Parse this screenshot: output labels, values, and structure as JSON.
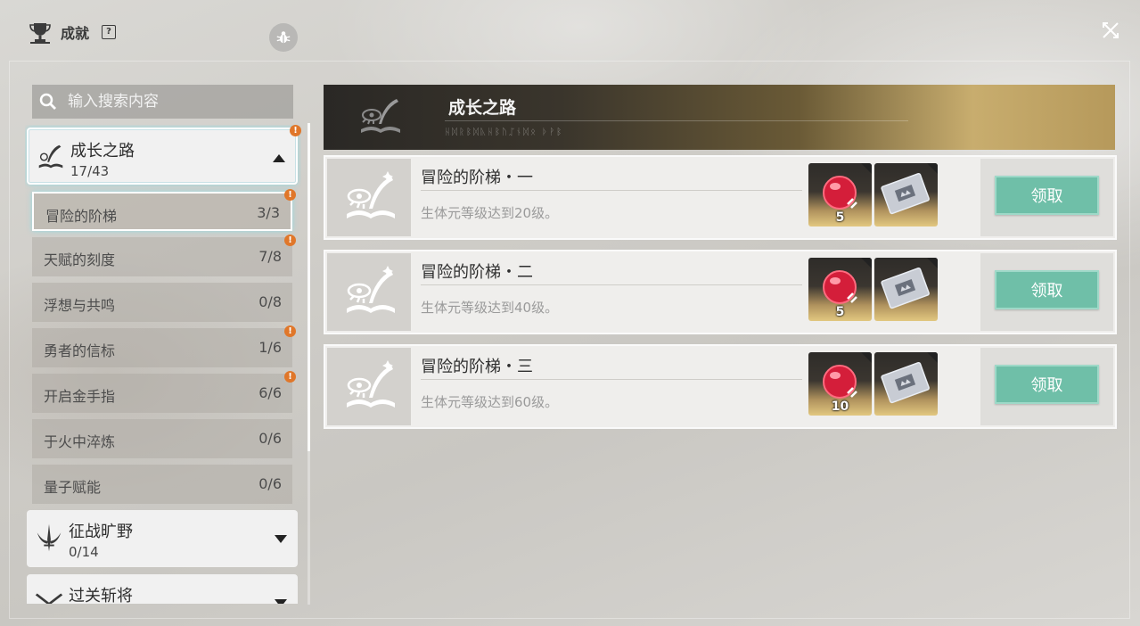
{
  "header": {
    "title": "成就",
    "help": "?"
  },
  "search": {
    "placeholder": "输入搜索内容"
  },
  "categories": [
    {
      "name": "成长之路",
      "count": "17/43",
      "expanded": true,
      "alert": true
    },
    {
      "name": "征战旷野",
      "count": "0/14",
      "expanded": false,
      "alert": false
    },
    {
      "name": "过关斩将",
      "count": "",
      "expanded": false,
      "alert": false
    }
  ],
  "subcategories": [
    {
      "name": "冒险的阶梯",
      "count": "3/3",
      "alert": true,
      "selected": true
    },
    {
      "name": "天赋的刻度",
      "count": "7/8",
      "alert": true
    },
    {
      "name": "浮想与共鸣",
      "count": "0/8",
      "alert": false
    },
    {
      "name": "勇者的信标",
      "count": "1/6",
      "alert": true
    },
    {
      "name": "开启金手指",
      "count": "6/6",
      "alert": true
    },
    {
      "name": "于火中淬炼",
      "count": "0/6",
      "alert": false
    },
    {
      "name": "量子赋能",
      "count": "0/6",
      "alert": false
    }
  ],
  "banner": {
    "title": "成长之路",
    "subtitle": "ᚺᛞᚱᛒᛞᚣᚺᛒᚢᛢᚾᛞᛟ ᚦᚹᛒ"
  },
  "achievements": [
    {
      "title": "冒险的阶梯・一",
      "desc": "生体元等级达到20级。",
      "reward1_qty": "5",
      "claim": "领取"
    },
    {
      "title": "冒险的阶梯・二",
      "desc": "生体元等级达到40级。",
      "reward1_qty": "5",
      "claim": "领取"
    },
    {
      "title": "冒险的阶梯・三",
      "desc": "生体元等级达到60级。",
      "reward1_qty": "10",
      "claim": "领取"
    }
  ],
  "colors": {
    "claim": "#6fbfa8",
    "alert": "#e0772a",
    "banner_gold": "#c8ad6e"
  }
}
